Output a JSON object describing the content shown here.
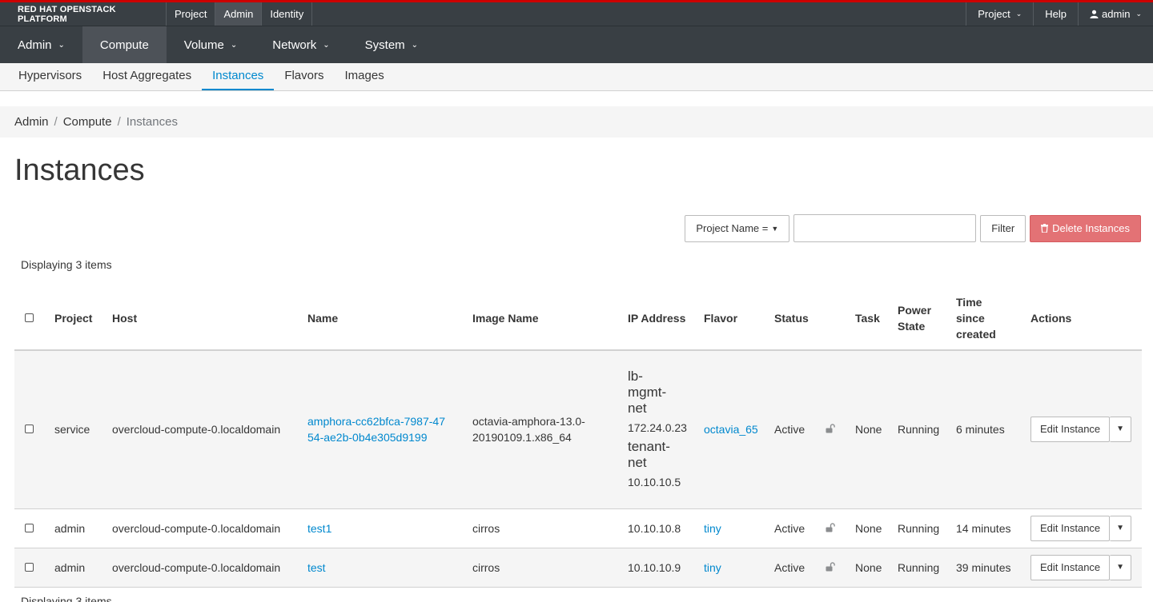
{
  "masthead": {
    "brand": "RED HAT OPENSTACK PLATFORM",
    "tabs": [
      {
        "label": "Project",
        "active": false
      },
      {
        "label": "Admin",
        "active": true
      },
      {
        "label": "Identity",
        "active": false
      }
    ],
    "right": {
      "project_menu": "Project",
      "help": "Help",
      "user": "admin"
    }
  },
  "nav_secondary": [
    {
      "label": "Admin",
      "active": false,
      "dropdown": true
    },
    {
      "label": "Compute",
      "active": true,
      "dropdown": false
    },
    {
      "label": "Volume",
      "active": false,
      "dropdown": true
    },
    {
      "label": "Network",
      "active": false,
      "dropdown": true
    },
    {
      "label": "System",
      "active": false,
      "dropdown": true
    }
  ],
  "nav_tertiary": [
    {
      "label": "Hypervisors",
      "active": false
    },
    {
      "label": "Host Aggregates",
      "active": false
    },
    {
      "label": "Instances",
      "active": true
    },
    {
      "label": "Flavors",
      "active": false
    },
    {
      "label": "Images",
      "active": false
    }
  ],
  "breadcrumb": [
    "Admin",
    "Compute",
    "Instances"
  ],
  "page_title": "Instances",
  "toolbar": {
    "filter_field": "Project Name =",
    "filter_value": "",
    "filter_button": "Filter",
    "delete_button": "Delete Instances"
  },
  "display_count": "Displaying 3 items",
  "table": {
    "headers": {
      "project": "Project",
      "host": "Host",
      "name": "Name",
      "image": "Image Name",
      "ip": "IP Address",
      "flavor": "Flavor",
      "status": "Status",
      "task": "Task",
      "power_line1": "Power",
      "power_line2": "State",
      "time_line1": "Time",
      "time_line2": "since",
      "time_line3": "created",
      "actions": "Actions"
    },
    "rows": [
      {
        "project": "service",
        "host": "overcloud-compute-0.localdomain",
        "name_line1": "amphora-cc62bfca-7987-47",
        "name_line2": "54-ae2b-0b4e305d9199",
        "image_line1": "octavia-amphora-13.0-",
        "image_line2": "20190109.1.x86_64",
        "net1_l1": "lb-",
        "net1_l2": "mgmt-",
        "net1_l3": "net",
        "ip1": "172.24.0.23",
        "net2_l1": "tenant-",
        "net2_l2": "net",
        "ip2": "10.10.10.5",
        "flavor": "octavia_65",
        "status": "Active",
        "task": "None",
        "power": "Running",
        "time": "6 minutes",
        "action": "Edit Instance"
      },
      {
        "project": "admin",
        "host": "overcloud-compute-0.localdomain",
        "name": "test1",
        "image": "cirros",
        "ip": "10.10.10.8",
        "flavor": "tiny",
        "status": "Active",
        "task": "None",
        "power": "Running",
        "time": "14 minutes",
        "action": "Edit Instance"
      },
      {
        "project": "admin",
        "host": "overcloud-compute-0.localdomain",
        "name": "test",
        "image": "cirros",
        "ip": "10.10.10.9",
        "flavor": "tiny",
        "status": "Active",
        "task": "None",
        "power": "Running",
        "time": "39 minutes",
        "action": "Edit Instance"
      }
    ]
  },
  "icons": {
    "caret": "caret-down-icon",
    "user": "user-icon",
    "trash": "trash-icon",
    "lock": "unlock-icon"
  },
  "colors": {
    "masthead_bg": "#393f44",
    "accent_red": "#cc0000",
    "link_blue": "#0088ce",
    "danger": "#e37275"
  }
}
